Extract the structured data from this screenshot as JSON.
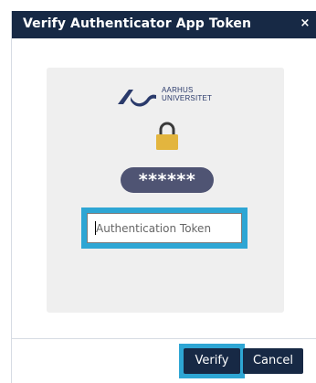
{
  "dialog": {
    "title": "Verify Authenticator App Token",
    "close_label": "×"
  },
  "panel": {
    "logo": {
      "line1": "AARHUS",
      "line2": "UNIVERSITET",
      "icon": "aarhus-university-logo-icon"
    },
    "lock_icon": "padlock-icon",
    "masked_code": "******",
    "token_input": {
      "placeholder": "Authentication Token",
      "value": ""
    }
  },
  "footer": {
    "verify_label": "Verify",
    "cancel_label": "Cancel"
  },
  "colors": {
    "header": "#172945",
    "focus_ring": "#2ea6d4",
    "panel_bg": "#efefef",
    "lock": "#e3b53e",
    "code_pill": "#4f5473"
  }
}
